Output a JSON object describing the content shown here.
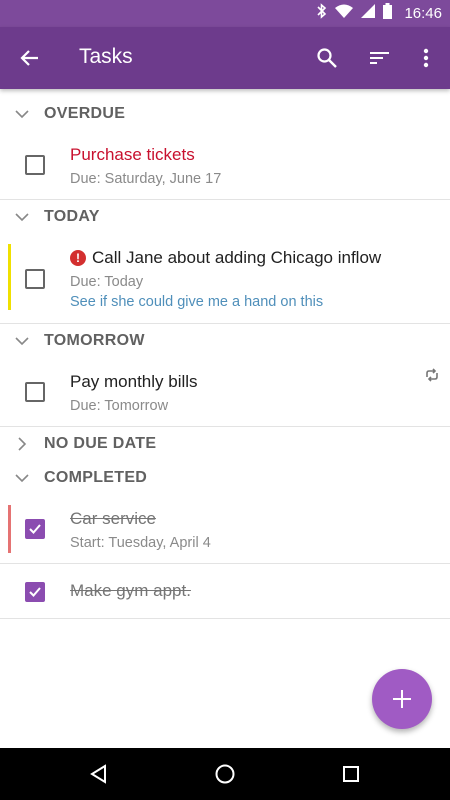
{
  "status_bar": {
    "time": "16:46",
    "icons": [
      "bluetooth-icon",
      "wifi-icon",
      "signal-icon",
      "battery-icon"
    ],
    "background": "#7d4a9b"
  },
  "app_bar": {
    "title": "Tasks",
    "background": "#6d3b8c",
    "icons": [
      "back-arrow-icon",
      "search-icon",
      "sort-icon",
      "more-vert-icon"
    ]
  },
  "sections": {
    "overdue": {
      "label": "OVERDUE",
      "expanded": true
    },
    "today": {
      "label": "TODAY",
      "expanded": true
    },
    "tomorrow": {
      "label": "TOMORROW",
      "expanded": true
    },
    "no_due_date": {
      "label": "NO DUE DATE",
      "expanded": false
    },
    "completed": {
      "label": "COMPLETED",
      "expanded": true
    }
  },
  "tasks": {
    "overdue_1": {
      "title": "Purchase tickets",
      "due": "Due: Saturday, June 17",
      "checked": false,
      "title_color": "#c8102e"
    },
    "today_1": {
      "title": "Call Jane about adding Chicago inflow",
      "due": "Due: Today",
      "note": "See if she could give me a hand on this",
      "checked": false,
      "priority": "high",
      "accent_color": "#f0e000"
    },
    "tomorrow_1": {
      "title": "Pay monthly bills",
      "due": "Due: Tomorrow",
      "checked": false,
      "recurring": true
    },
    "completed_1": {
      "title": "Car service",
      "start": "Start: Tuesday, April 4",
      "checked": true,
      "accent_color": "#e57373"
    },
    "completed_2": {
      "title": "Make gym appt.",
      "checked": true
    }
  },
  "fab": {
    "icon": "plus-icon",
    "color": "#a05bc4"
  },
  "nav_bar": {
    "icons": [
      "back-triangle-icon",
      "home-circle-icon",
      "recents-square-icon"
    ]
  },
  "colors": {
    "accent": "#8b4cb0",
    "note_link": "#4f8fba"
  }
}
